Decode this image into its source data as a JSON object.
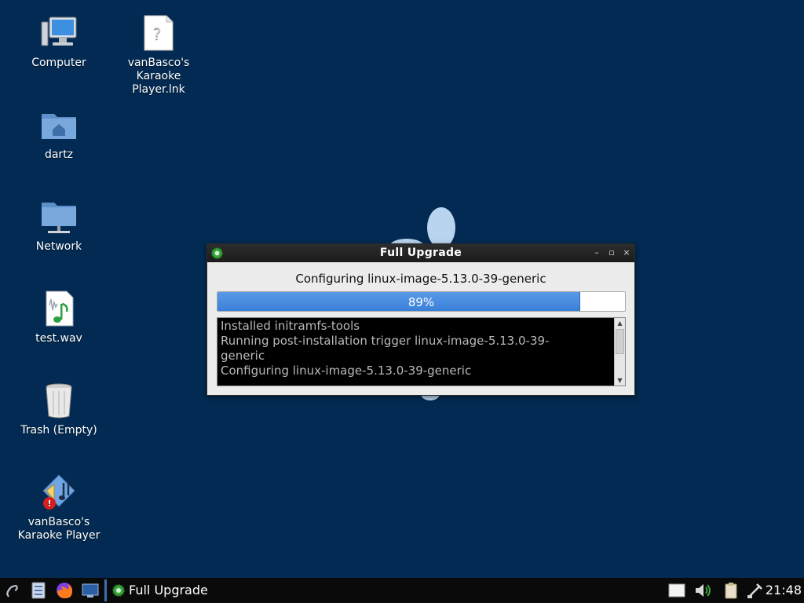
{
  "desktop": {
    "icons": [
      {
        "label": "Computer",
        "icon": "computer-icon"
      },
      {
        "label": "dartz",
        "icon": "home-folder-icon"
      },
      {
        "label": "Network",
        "icon": "network-folder-icon"
      },
      {
        "label": "test.wav",
        "icon": "audio-file-icon"
      },
      {
        "label": "Trash (Empty)",
        "icon": "trash-icon"
      },
      {
        "label": "vanBasco's Karaoke Player",
        "icon": "karaoke-player-icon"
      },
      {
        "label": "vanBasco's Karaoke Player.lnk",
        "icon": "unknown-file-icon"
      }
    ]
  },
  "dialog": {
    "title": "Full Upgrade",
    "status": "Configuring linux-image-5.13.0-39-generic",
    "progress": {
      "value": 0.89,
      "label": "89%"
    },
    "log_lines": [
      "Installed initramfs-tools",
      "Running post-installation trigger linux-image-5.13.0-39-",
      "generic",
      "Configuring linux-image-5.13.0-39-generic"
    ],
    "buttons": {
      "minimize": "–",
      "maximize": "▫",
      "close": "×"
    }
  },
  "taskbar": {
    "launchers": [
      "menu-icon",
      "file-manager-icon",
      "firefox-icon",
      "desktop-icon"
    ],
    "task": {
      "label": "Full Upgrade",
      "icon": "gear-icon"
    },
    "tray": [
      "notes-icon",
      "volume-icon",
      "clipboard-icon",
      "network-icon"
    ],
    "clock": "21:48"
  },
  "colors": {
    "desktop_bg": "#022a52",
    "progress": "#4a8de0",
    "taskbar": "#0a0a0a"
  }
}
